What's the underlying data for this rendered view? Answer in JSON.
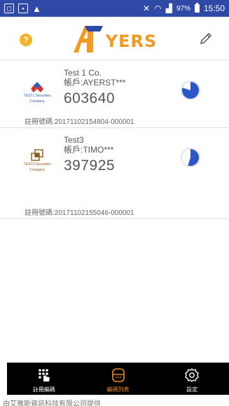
{
  "status_bar": {
    "battery_percent": "97%",
    "time": "15:50",
    "left_icons": [
      "notification-icon",
      "image-icon",
      "warning-icon"
    ],
    "right_icons": [
      "mute-icon",
      "wifi-icon",
      "signal-icon",
      "battery-icon"
    ]
  },
  "header": {
    "logo_text": "YERS",
    "help_label": "?",
    "colors": {
      "logo": "#f29a1f",
      "help": "#f4b224"
    }
  },
  "tokens": [
    {
      "company": "Test 1 Co.",
      "account": "帳戶:AYERST***",
      "code": "603640",
      "registration": "註冊號碼:20171102154804-000001",
      "logo_caption_1": "TEST1 Securities",
      "logo_caption_2": "Company",
      "timer_remaining_fraction": 0.8
    },
    {
      "company": "Test3",
      "account": "帳戶:TIMO***",
      "code": "397925",
      "registration": "註冊號碼:20171102155046-000001",
      "logo_caption_1": "TEST3 Securities",
      "logo_caption_2": "Company",
      "timer_remaining_fraction": 0.55
    }
  ],
  "nav": {
    "register_label": "註冊編碼",
    "list_label": "編碼列表",
    "settings_label": "設定",
    "active": "list",
    "colors": {
      "active": "#f08a1c",
      "background": "#000000"
    }
  },
  "footer": "由艾雅斯資訊科技有限公司提供"
}
